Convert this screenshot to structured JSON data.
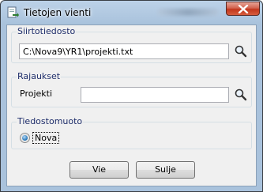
{
  "window": {
    "title": "Tietojen vienti"
  },
  "groups": {
    "source_file": {
      "legend": "Siirtotiedosto",
      "path": "C:\\Nova9\\YR1\\projekti.txt"
    },
    "filters": {
      "legend": "Rajaukset",
      "project_label": "Projekti",
      "project_value": ""
    },
    "format": {
      "legend": "Tiedostomuoto",
      "option_label": "Nova",
      "option_selected": true
    }
  },
  "buttons": {
    "export_label": "Vie",
    "close_label": "Sulje"
  },
  "icons": {
    "app": "document-export-icon",
    "close": "close-icon",
    "search": "magnifier-icon"
  },
  "colors": {
    "frame": "#a9c2dc",
    "legend_text": "#1f2e6b",
    "close_button": "#c2361c"
  }
}
